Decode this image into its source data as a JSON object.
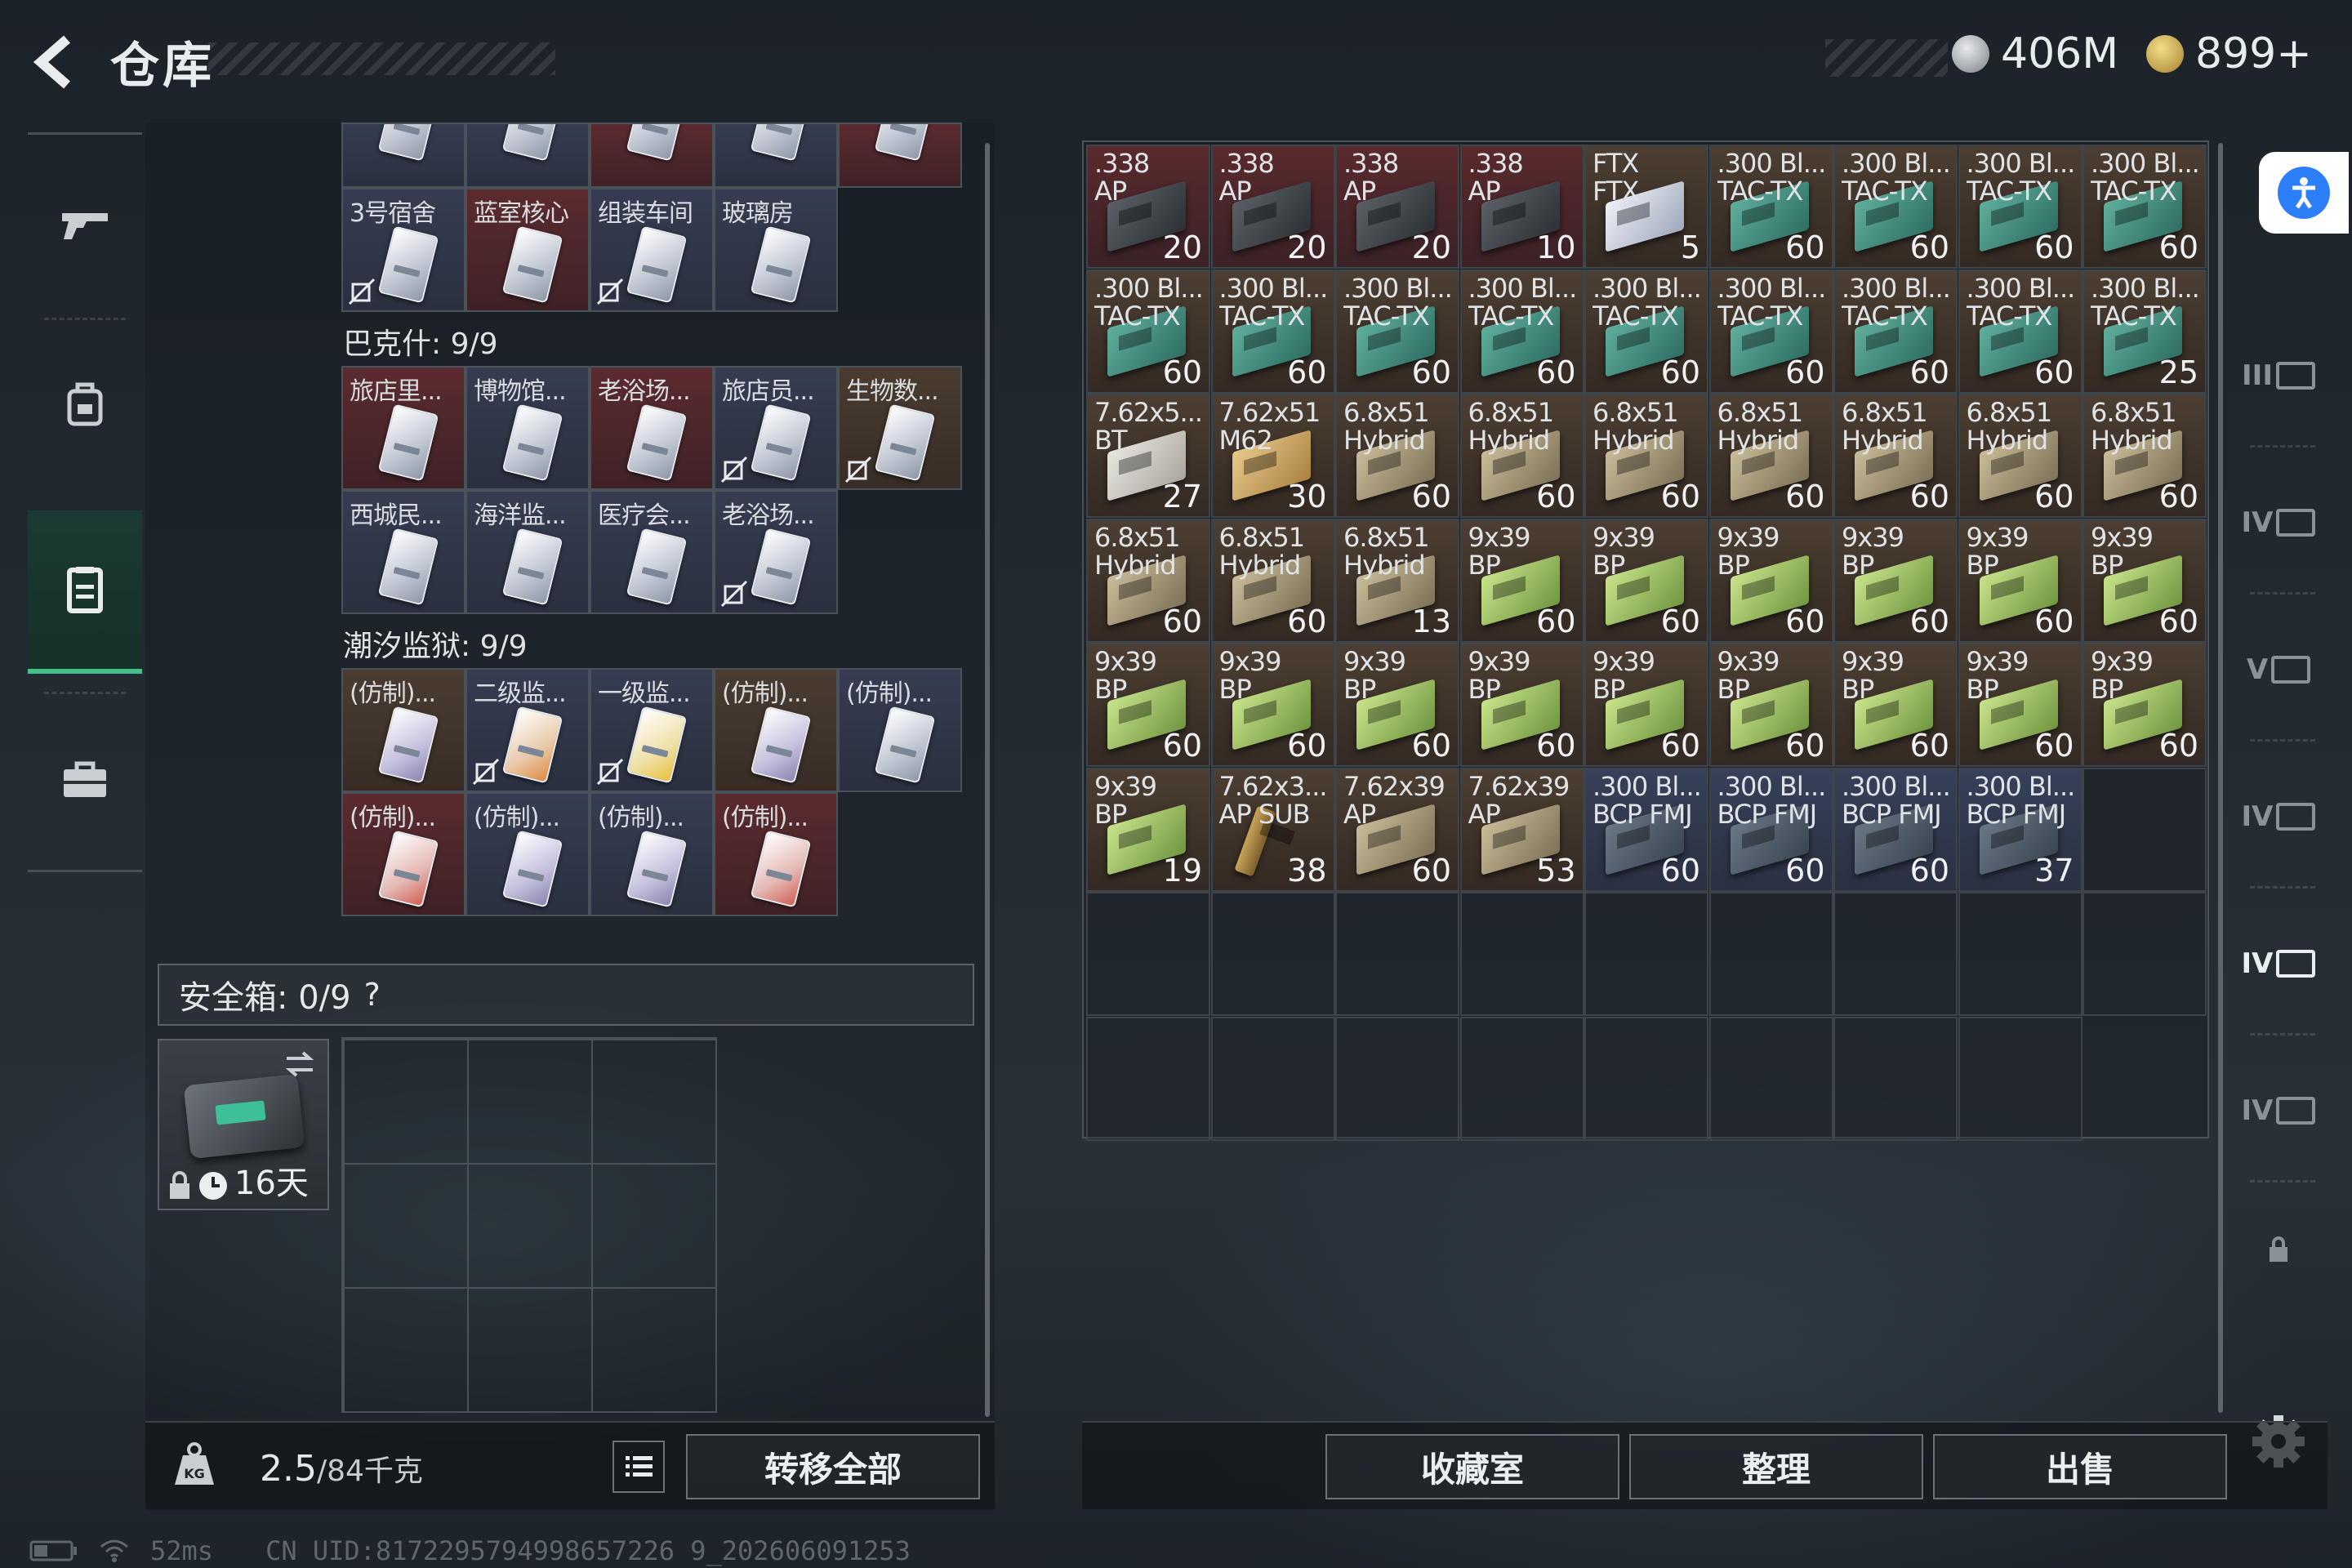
{
  "header": {
    "title": "仓库",
    "currency1": "406M",
    "currency2": "899+"
  },
  "left": {
    "row0": [
      {
        "label": "",
        "bg": "blue",
        "card": "white"
      },
      {
        "label": "",
        "bg": "blue",
        "card": "white"
      },
      {
        "label": "",
        "bg": "red",
        "card": "white"
      },
      {
        "label": "",
        "bg": "blue",
        "card": "white"
      },
      {
        "label": "",
        "bg": "red",
        "card": "white"
      }
    ],
    "row1": [
      {
        "label": "3号宿舍",
        "bg": "blue",
        "card": "white",
        "locked": true
      },
      {
        "label": "蓝室核心",
        "bg": "red",
        "card": "white",
        "locked": false
      },
      {
        "label": "组装车间",
        "bg": "blue",
        "card": "white",
        "locked": true
      },
      {
        "label": "玻璃房",
        "bg": "blue",
        "card": "white",
        "locked": false
      }
    ],
    "group1_title": "巴克什: 9/9",
    "group1": [
      {
        "label": "旅店里...",
        "bg": "red",
        "card": "white",
        "locked": false
      },
      {
        "label": "博物馆...",
        "bg": "blue",
        "card": "white",
        "locked": false
      },
      {
        "label": "老浴场...",
        "bg": "red",
        "card": "white",
        "locked": false
      },
      {
        "label": "旅店员...",
        "bg": "blue",
        "card": "white",
        "locked": true
      },
      {
        "label": "生物数...",
        "bg": "brown",
        "card": "white",
        "locked": true
      },
      {
        "label": "西城民...",
        "bg": "blue",
        "card": "white",
        "locked": false
      },
      {
        "label": "海洋监...",
        "bg": "blue",
        "card": "white",
        "locked": false
      },
      {
        "label": "医疗会...",
        "bg": "blue",
        "card": "white",
        "locked": false
      },
      {
        "label": "老浴场...",
        "bg": "blue",
        "card": "white",
        "locked": true
      }
    ],
    "group2_title": "潮汐监狱: 9/9",
    "group2": [
      {
        "label": "(仿制)...",
        "bg": "brown",
        "card": "purple",
        "locked": false
      },
      {
        "label": "二级监...",
        "bg": "blue",
        "card": "orange",
        "locked": true
      },
      {
        "label": "一级监...",
        "bg": "blue",
        "card": "yellow",
        "locked": true
      },
      {
        "label": "(仿制)...",
        "bg": "brown",
        "card": "purple",
        "locked": false
      },
      {
        "label": "(仿制)...",
        "bg": "blue",
        "card": "white",
        "locked": false
      },
      {
        "label": "(仿制)...",
        "bg": "red",
        "card": "redc",
        "locked": false
      },
      {
        "label": "(仿制)...",
        "bg": "blue",
        "card": "purple",
        "locked": false
      },
      {
        "label": "(仿制)...",
        "bg": "blue",
        "card": "purple",
        "locked": false
      },
      {
        "label": "(仿制)...",
        "bg": "red",
        "card": "redc",
        "locked": false
      }
    ],
    "safe_label": "安全箱: 0/9",
    "safe_help": "?",
    "safe_days": "16天",
    "weight_current": "2.5",
    "weight_max": "/84千克",
    "transfer_all": "转移全部"
  },
  "storage": {
    "items": [
      {
        "l1": ".338",
        "l2": "AP",
        "count": "20",
        "bg": "red",
        "box": "dark"
      },
      {
        "l1": ".338",
        "l2": "AP",
        "count": "20",
        "bg": "red",
        "box": "dark"
      },
      {
        "l1": ".338",
        "l2": "AP",
        "count": "20",
        "bg": "red",
        "box": "dark"
      },
      {
        "l1": ".338",
        "l2": "AP",
        "count": "10",
        "bg": "red",
        "box": "dark"
      },
      {
        "l1": "FTX",
        "l2": "FTX",
        "count": "5",
        "bg": "brown",
        "box": "ftx"
      },
      {
        "l1": ".300 Bl...",
        "l2": "TAC-TX",
        "count": "60",
        "bg": "brown",
        "box": "teal"
      },
      {
        "l1": ".300 Bl...",
        "l2": "TAC-TX",
        "count": "60",
        "bg": "brown",
        "box": "teal"
      },
      {
        "l1": ".300 Bl...",
        "l2": "TAC-TX",
        "count": "60",
        "bg": "brown",
        "box": "teal"
      },
      {
        "l1": ".300 Bl...",
        "l2": "TAC-TX",
        "count": "60",
        "bg": "brown",
        "box": "teal"
      },
      {
        "l1": ".300 Bl...",
        "l2": "TAC-TX",
        "count": "60",
        "bg": "brown",
        "box": "teal"
      },
      {
        "l1": ".300 Bl...",
        "l2": "TAC-TX",
        "count": "60",
        "bg": "brown",
        "box": "teal"
      },
      {
        "l1": ".300 Bl...",
        "l2": "TAC-TX",
        "count": "60",
        "bg": "brown",
        "box": "teal"
      },
      {
        "l1": ".300 Bl...",
        "l2": "TAC-TX",
        "count": "60",
        "bg": "brown",
        "box": "teal"
      },
      {
        "l1": ".300 Bl...",
        "l2": "TAC-TX",
        "count": "60",
        "bg": "brown",
        "box": "teal"
      },
      {
        "l1": ".300 Bl...",
        "l2": "TAC-TX",
        "count": "60",
        "bg": "brown",
        "box": "teal"
      },
      {
        "l1": ".300 Bl...",
        "l2": "TAC-TX",
        "count": "60",
        "bg": "brown",
        "box": "teal"
      },
      {
        "l1": ".300 Bl...",
        "l2": "TAC-TX",
        "count": "60",
        "bg": "brown",
        "box": "teal"
      },
      {
        "l1": ".300 Bl...",
        "l2": "TAC-TX",
        "count": "25",
        "bg": "brown",
        "box": "teal"
      },
      {
        "l1": "7.62x5...",
        "l2": "BT",
        "count": "27",
        "bg": "brown",
        "box": "white"
      },
      {
        "l1": "7.62x51",
        "l2": "M62",
        "count": "30",
        "bg": "brown",
        "box": "tan"
      },
      {
        "l1": "6.8x51",
        "l2": "Hybrid",
        "count": "60",
        "bg": "brown",
        "box": "khaki"
      },
      {
        "l1": "6.8x51",
        "l2": "Hybrid",
        "count": "60",
        "bg": "brown",
        "box": "khaki"
      },
      {
        "l1": "6.8x51",
        "l2": "Hybrid",
        "count": "60",
        "bg": "brown",
        "box": "khaki"
      },
      {
        "l1": "6.8x51",
        "l2": "Hybrid",
        "count": "60",
        "bg": "brown",
        "box": "khaki"
      },
      {
        "l1": "6.8x51",
        "l2": "Hybrid",
        "count": "60",
        "bg": "brown",
        "box": "khaki"
      },
      {
        "l1": "6.8x51",
        "l2": "Hybrid",
        "count": "60",
        "bg": "brown",
        "box": "khaki"
      },
      {
        "l1": "6.8x51",
        "l2": "Hybrid",
        "count": "60",
        "bg": "brown",
        "box": "khaki"
      },
      {
        "l1": "6.8x51",
        "l2": "Hybrid",
        "count": "60",
        "bg": "brown",
        "box": "khaki"
      },
      {
        "l1": "6.8x51",
        "l2": "Hybrid",
        "count": "60",
        "bg": "brown",
        "box": "khaki"
      },
      {
        "l1": "6.8x51",
        "l2": "Hybrid",
        "count": "13",
        "bg": "brown",
        "box": "khaki"
      },
      {
        "l1": "9x39",
        "l2": "BP",
        "count": "60",
        "bg": "brown",
        "box": "green"
      },
      {
        "l1": "9x39",
        "l2": "BP",
        "count": "60",
        "bg": "brown",
        "box": "green"
      },
      {
        "l1": "9x39",
        "l2": "BP",
        "count": "60",
        "bg": "brown",
        "box": "green"
      },
      {
        "l1": "9x39",
        "l2": "BP",
        "count": "60",
        "bg": "brown",
        "box": "green"
      },
      {
        "l1": "9x39",
        "l2": "BP",
        "count": "60",
        "bg": "brown",
        "box": "green"
      },
      {
        "l1": "9x39",
        "l2": "BP",
        "count": "60",
        "bg": "brown",
        "box": "green"
      },
      {
        "l1": "9x39",
        "l2": "BP",
        "count": "60",
        "bg": "brown",
        "box": "green"
      },
      {
        "l1": "9x39",
        "l2": "BP",
        "count": "60",
        "bg": "brown",
        "box": "green"
      },
      {
        "l1": "9x39",
        "l2": "BP",
        "count": "60",
        "bg": "brown",
        "box": "green"
      },
      {
        "l1": "9x39",
        "l2": "BP",
        "count": "60",
        "bg": "brown",
        "box": "green"
      },
      {
        "l1": "9x39",
        "l2": "BP",
        "count": "60",
        "bg": "brown",
        "box": "green"
      },
      {
        "l1": "9x39",
        "l2": "BP",
        "count": "60",
        "bg": "brown",
        "box": "green"
      },
      {
        "l1": "9x39",
        "l2": "BP",
        "count": "60",
        "bg": "brown",
        "box": "green"
      },
      {
        "l1": "9x39",
        "l2": "BP",
        "count": "60",
        "bg": "brown",
        "box": "green"
      },
      {
        "l1": "9x39",
        "l2": "BP",
        "count": "60",
        "bg": "brown",
        "box": "green"
      },
      {
        "l1": "9x39",
        "l2": "BP",
        "count": "19",
        "bg": "brown",
        "box": "green"
      },
      {
        "l1": "7.62x3...",
        "l2": "AP SUB",
        "count": "38",
        "bg": "brown",
        "box": "bullet"
      },
      {
        "l1": "7.62x39",
        "l2": "AP",
        "count": "60",
        "bg": "brown",
        "box": "khaki"
      },
      {
        "l1": "7.62x39",
        "l2": "AP",
        "count": "53",
        "bg": "brown",
        "box": "khaki"
      },
      {
        "l1": ".300 Bl...",
        "l2": "BCP FMJ",
        "count": "60",
        "bg": "blue",
        "box": "slate"
      },
      {
        "l1": ".300 Bl...",
        "l2": "BCP FMJ",
        "count": "60",
        "bg": "blue",
        "box": "slate"
      },
      {
        "l1": ".300 Bl...",
        "l2": "BCP FMJ",
        "count": "60",
        "bg": "blue",
        "box": "slate"
      },
      {
        "l1": ".300 Bl...",
        "l2": "BCP FMJ",
        "count": "37",
        "bg": "blue",
        "box": "slate"
      }
    ],
    "empty_cells": 16
  },
  "right_tabs": [
    "III",
    "IV",
    "V",
    "IV",
    "IV",
    "IV"
  ],
  "buttons": {
    "collection": "收藏室",
    "sort": "整理",
    "sell": "出售"
  },
  "status": {
    "ping": "52ms",
    "uid": "CN UID:8172295794998657226 9_202606091253"
  }
}
